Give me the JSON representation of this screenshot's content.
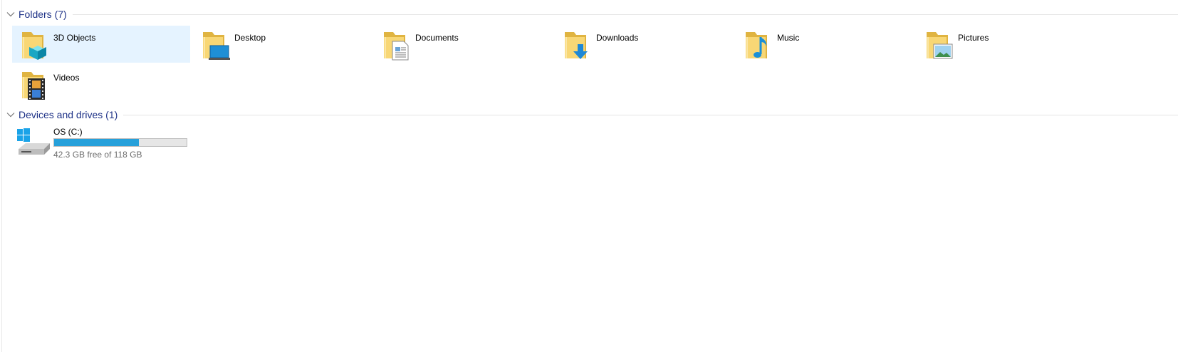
{
  "groups": {
    "folders": {
      "title": "Folders (7)"
    },
    "devices": {
      "title": "Devices and drives (1)"
    }
  },
  "folders": [
    {
      "label": "3D Objects",
      "icon": "3d-objects-folder-icon",
      "selected": true
    },
    {
      "label": "Desktop",
      "icon": "desktop-folder-icon"
    },
    {
      "label": "Documents",
      "icon": "documents-folder-icon"
    },
    {
      "label": "Downloads",
      "icon": "downloads-folder-icon"
    },
    {
      "label": "Music",
      "icon": "music-folder-icon"
    },
    {
      "label": "Pictures",
      "icon": "pictures-folder-icon"
    },
    {
      "label": "Videos",
      "icon": "videos-folder-icon"
    }
  ],
  "drive": {
    "name": "OS (C:)",
    "free_text": "42.3 GB free of 118 GB",
    "used_fraction": 0.64,
    "icon": "windows-drive-icon"
  },
  "colors": {
    "header_text": "#1e3287",
    "selection": "#e5f3ff",
    "usage_bar": "#26a0da",
    "folder_yellow": "#f8d775"
  }
}
